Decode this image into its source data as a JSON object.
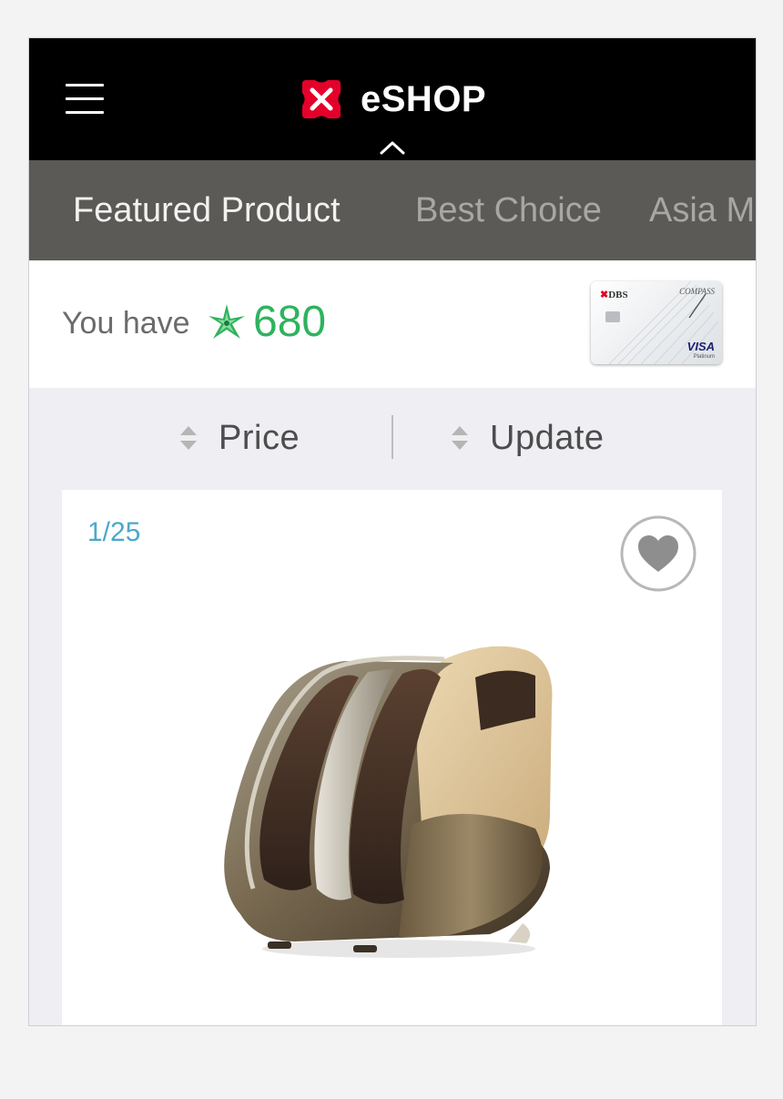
{
  "header": {
    "title": "eSHOP",
    "menu_icon": "hamburger-menu-icon",
    "logo_icon": "dbs-logo-icon",
    "collapse_icon": "chevron-up-icon"
  },
  "tabs": [
    {
      "label": "Featured Product",
      "active": true
    },
    {
      "label": "Best Choice",
      "active": false
    },
    {
      "label": "Asia M",
      "active": false
    }
  ],
  "points": {
    "label": "You have",
    "value": "680",
    "icon": "star-burst-icon",
    "color": "#2eb35e"
  },
  "card": {
    "bank": "DBS",
    "series": "COMPASS",
    "network": "VISA",
    "tier": "Platinum"
  },
  "sort": {
    "price_label": "Price",
    "update_label": "Update"
  },
  "product": {
    "counter": "1/25",
    "favorite_icon": "heart-icon",
    "image": "foot-massager-image"
  },
  "colors": {
    "header_bg": "#000000",
    "tabs_bg": "#5c5a57",
    "brand_red": "#e4002b",
    "counter": "#4aa8cc"
  }
}
